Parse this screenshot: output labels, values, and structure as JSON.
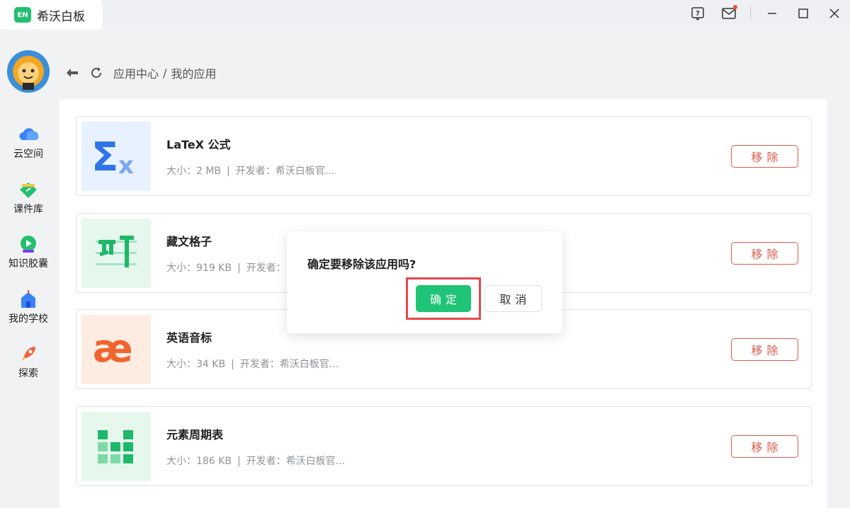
{
  "window": {
    "app_logo_text": "EN",
    "app_title": "希沃白板",
    "icons": [
      "help-icon",
      "mail-icon",
      "minimize-icon",
      "maximize-icon",
      "close-icon"
    ]
  },
  "sidebar": {
    "items": [
      {
        "label": "云空间",
        "icon": "cloud-icon"
      },
      {
        "label": "课件库",
        "icon": "courseware-icon"
      },
      {
        "label": "知识胶囊",
        "icon": "capsule-icon"
      },
      {
        "label": "我的学校",
        "icon": "school-icon"
      },
      {
        "label": "探索",
        "icon": "rocket-icon"
      }
    ]
  },
  "header": {
    "crumb_parent": "应用中心",
    "crumb_separator": "/",
    "crumb_current": "我的应用"
  },
  "apps": [
    {
      "name": "LaTeX 公式",
      "size": "大小：2 MB",
      "developer": "开发者：希沃白板官...",
      "remove_label": "移除",
      "icon": "sigma-x-icon"
    },
    {
      "name": "藏文格子",
      "size": "大小：919 KB",
      "developer": "开发者：",
      "remove_label": "移除",
      "icon": "tibetan-grid-icon"
    },
    {
      "name": "英语音标",
      "size": "大小：34 KB",
      "developer": "开发者：希沃白板官...",
      "remove_label": "移除",
      "icon": "ae-ligature-icon"
    },
    {
      "name": "元素周期表",
      "size": "大小：186 KB",
      "developer": "开发者：希沃白板官...",
      "remove_label": "移除",
      "icon": "periodic-table-icon"
    }
  ],
  "meta_separator": "|",
  "dialog": {
    "message": "确定要移除该应用吗?",
    "confirm_label": "确定",
    "cancel_label": "取消"
  },
  "colors": {
    "brand_green": "#1fc476",
    "danger_red": "#e25a4a",
    "highlight_red": "#e5484d"
  }
}
